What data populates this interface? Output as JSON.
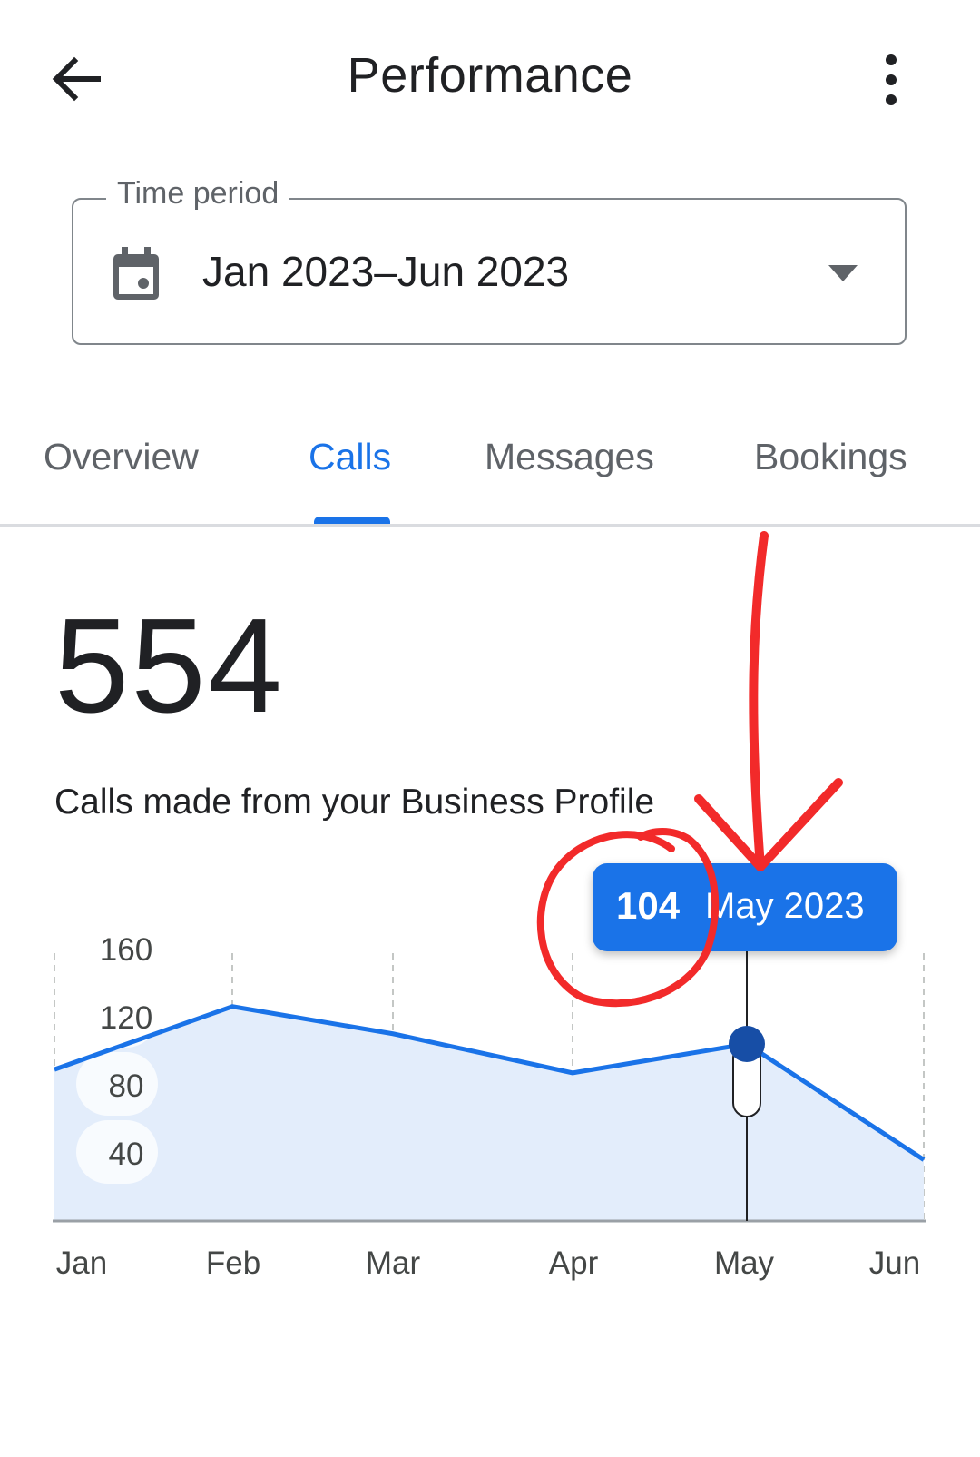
{
  "header": {
    "title": "Performance",
    "back_icon": "arrow-back-icon",
    "more_icon": "more-vert-icon"
  },
  "time_period": {
    "label": "Time period",
    "value": "Jan 2023–Jun 2023",
    "icon": "calendar-icon",
    "dropdown_icon": "arrow-drop-down-icon"
  },
  "tabs": [
    {
      "label": "Overview",
      "active": false
    },
    {
      "label": "Calls",
      "active": true
    },
    {
      "label": "Messages",
      "active": false
    },
    {
      "label": "Bookings",
      "active": false
    }
  ],
  "metric": {
    "value": "554",
    "label": "Calls made from your Business Profile"
  },
  "tooltip": {
    "value": "104",
    "date": "May 2023"
  },
  "colors": {
    "accent": "#1a73e8",
    "fill": "#e3edfb",
    "annotation": "#f22a2a"
  },
  "chart_data": {
    "type": "area",
    "categories": [
      "Jan",
      "Feb",
      "Mar",
      "Apr",
      "May",
      "Jun"
    ],
    "y_ticks": [
      "160",
      "120",
      "80",
      "40"
    ],
    "ylim": [
      0,
      160
    ],
    "series": [
      {
        "values": [
          89,
          126,
          110,
          87,
          104,
          36
        ]
      }
    ],
    "highlighted_index": 4,
    "grid": "vertical-dashed"
  }
}
